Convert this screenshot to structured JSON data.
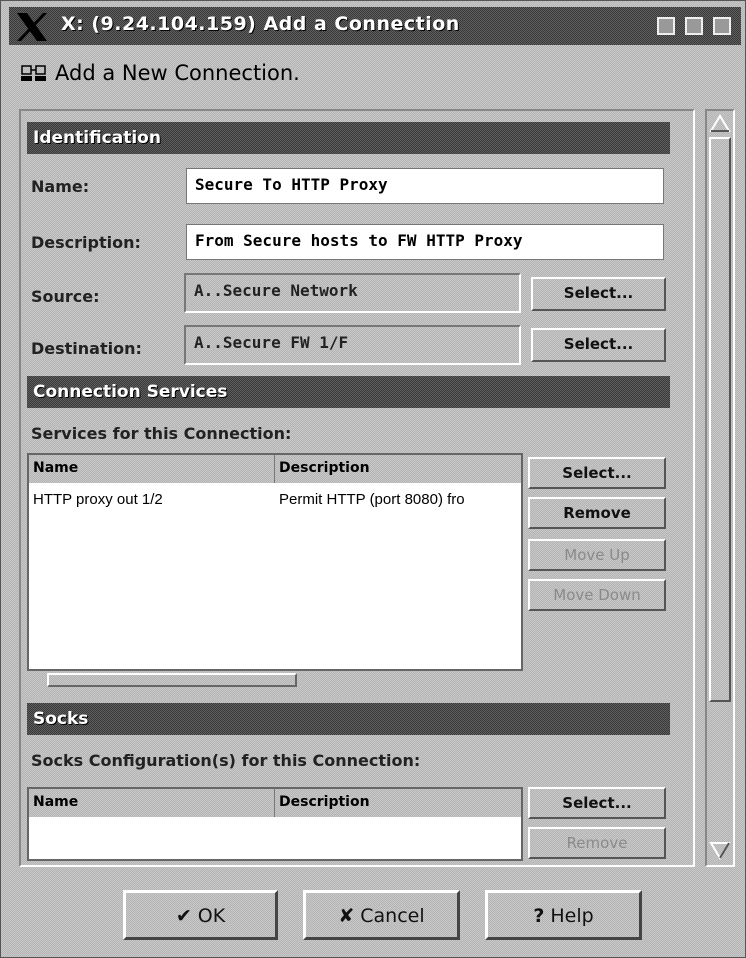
{
  "window": {
    "title": "X: (9.24.104.159) Add a Connection"
  },
  "dialog": {
    "heading": "Add a New Connection.",
    "heading_icon": "network-computers-icon"
  },
  "identification": {
    "header": "Identification",
    "name_label": "Name:",
    "name_value": "Secure To HTTP Proxy",
    "description_label": "Description:",
    "description_value": "From Secure hosts to FW HTTP Proxy",
    "source_label": "Source:",
    "source_value": "A..Secure Network",
    "source_select": "Select...",
    "destination_label": "Destination:",
    "destination_value": "A..Secure FW 1/F",
    "destination_select": "Select..."
  },
  "services": {
    "header": "Connection Services",
    "sublabel": "Services for this Connection:",
    "columns": [
      "Name",
      "Description"
    ],
    "rows": [
      {
        "name": "HTTP proxy out 1/2",
        "description": "Permit HTTP (port 8080) fro"
      }
    ],
    "buttons": {
      "select": "Select...",
      "remove": "Remove",
      "move_up": "Move Up",
      "move_down": "Move Down"
    }
  },
  "socks": {
    "header": "Socks",
    "sublabel": "Socks Configuration(s) for this Connection:",
    "columns": [
      "Name",
      "Description"
    ],
    "buttons": {
      "select": "Select...",
      "remove": "Remove"
    }
  },
  "footer": {
    "ok": "OK",
    "cancel": "Cancel",
    "help": "Help"
  }
}
